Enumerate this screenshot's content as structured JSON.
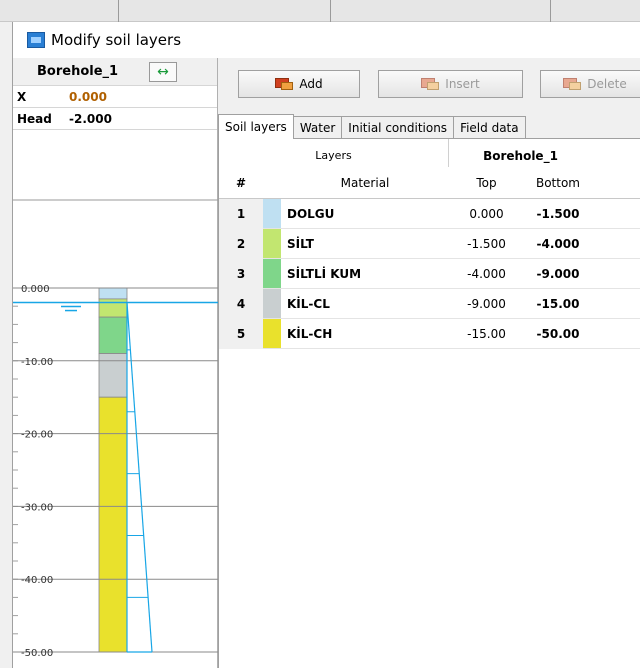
{
  "window": {
    "title": "Modify soil layers"
  },
  "borehole_panel": {
    "name": "Borehole_1",
    "x_label": "X",
    "x_value": "0.000",
    "head_label": "Head",
    "head_value": "-2.000",
    "axis_labels": [
      "0.000",
      "-10.00",
      "-20.00",
      "-30.00",
      "-40.00",
      "-50.00"
    ],
    "water_level": -2.0,
    "depth_min": 0,
    "depth_max": -50
  },
  "toolbar": {
    "add_label": "Add",
    "insert_label": "Insert",
    "delete_label": "Delete"
  },
  "tabs": [
    "Soil layers",
    "Water",
    "Initial conditions",
    "Field data"
  ],
  "table": {
    "group_layers": "Layers",
    "group_borehole": "Borehole_1",
    "col_num": "#",
    "col_material": "Material",
    "col_top": "Top",
    "col_bottom": "Bottom",
    "rows": [
      {
        "num": "1",
        "material": "DOLGU",
        "top": "0.000",
        "bottom": "-1.500",
        "color": "#bfe0f2"
      },
      {
        "num": "2",
        "material": "SİLT",
        "top": "-1.500",
        "bottom": "-4.000",
        "color": "#c2e670"
      },
      {
        "num": "3",
        "material": "SİLTLİ KUM",
        "top": "-4.000",
        "bottom": "-9.000",
        "color": "#7fd68a"
      },
      {
        "num": "4",
        "material": "KİL-CL",
        "top": "-9.000",
        "bottom": "-15.00",
        "color": "#c9cfd0"
      },
      {
        "num": "5",
        "material": "KİL-CH",
        "top": "-15.00",
        "bottom": "-50.00",
        "color": "#e9e12c"
      }
    ]
  },
  "colors": {
    "water": "#18a6e6",
    "accent": "#2a7fd4"
  }
}
